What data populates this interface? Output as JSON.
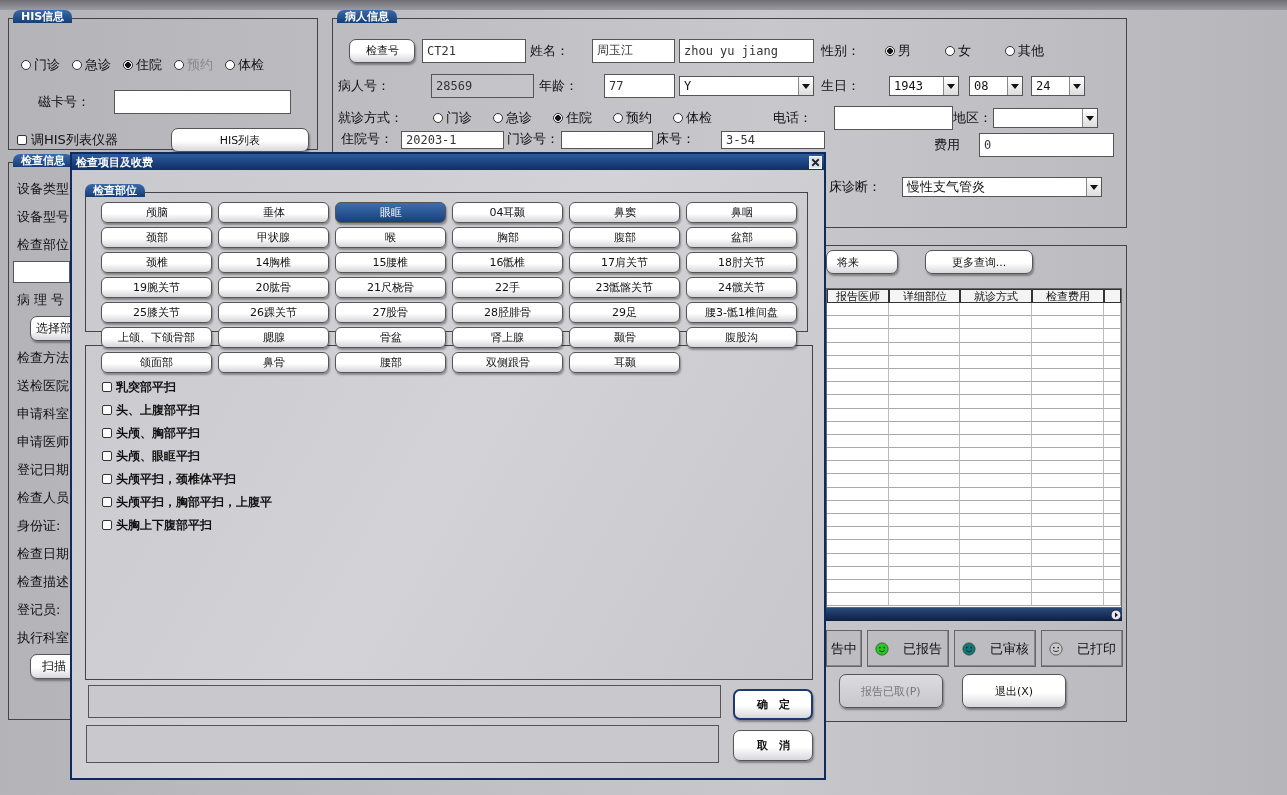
{
  "his": {
    "title": "HIS信息",
    "visit_types": [
      {
        "label": "门诊",
        "selected": false,
        "disabled": false
      },
      {
        "label": "急诊",
        "selected": false,
        "disabled": false
      },
      {
        "label": "住院",
        "selected": true,
        "disabled": false
      },
      {
        "label": "预约",
        "selected": false,
        "disabled": true
      },
      {
        "label": "体检",
        "selected": false,
        "disabled": false
      }
    ],
    "card_label": "磁卡号：",
    "checkbox": {
      "label": "调HIS列表仪器",
      "checked": false
    },
    "button": "HIS列表"
  },
  "exam_info": {
    "title": "检查信息",
    "items": [
      {
        "kind": "label",
        "text": "设备类型"
      },
      {
        "kind": "label",
        "text": "设备型号"
      },
      {
        "kind": "label",
        "text": "检查部位"
      },
      {
        "kind": "field"
      },
      {
        "kind": "label",
        "text": "病 理 号"
      },
      {
        "kind": "button",
        "text": "选择部"
      },
      {
        "kind": "label",
        "text": "检查方法"
      },
      {
        "kind": "label",
        "text": "送检医院"
      },
      {
        "kind": "label",
        "text": "申请科室"
      },
      {
        "kind": "label",
        "text": "申请医师"
      },
      {
        "kind": "label",
        "text": "登记日期"
      },
      {
        "kind": "label",
        "text": "检查人员"
      },
      {
        "kind": "label",
        "text": "身份证:"
      },
      {
        "kind": "label",
        "text": "检查日期"
      },
      {
        "kind": "label",
        "text": "检查描述"
      },
      {
        "kind": "label",
        "text": "登记员:"
      },
      {
        "kind": "label",
        "text": "执行科室"
      },
      {
        "kind": "button",
        "text": "扫描"
      }
    ]
  },
  "patient": {
    "title": "病人信息",
    "exam_no_button": "检查号",
    "exam_no": "CT21",
    "name_label": "姓名：",
    "name": "周玉江",
    "name_pinyin": "zhou yu jiang",
    "gender_label": "性别：",
    "genders": [
      {
        "label": "男",
        "selected": true
      },
      {
        "label": "女",
        "selected": false
      },
      {
        "label": "其他",
        "selected": false
      }
    ],
    "patient_no_label": "病人号：",
    "patient_no": "28569",
    "age_label": "年龄：",
    "age": "77",
    "age_unit": "Y",
    "birthday_label": "生日：",
    "birth_year": "1943",
    "birth_month": "08",
    "birth_day": "24",
    "visit_label": "就诊方式：",
    "visits": [
      {
        "label": "门诊",
        "selected": false
      },
      {
        "label": "急诊",
        "selected": false
      },
      {
        "label": "住院",
        "selected": true
      },
      {
        "label": "预约",
        "selected": false
      },
      {
        "label": "体检",
        "selected": false
      }
    ],
    "phone_label": "电话：",
    "region_label": "地区：",
    "inpatient_label": "住院号：",
    "inpatient_no": "20203-1",
    "outpatient_label": "门诊号：",
    "bed_label": "床号：",
    "bed_no": "3-54",
    "fee_label": "费用",
    "fee": "0",
    "diagnosis_label": "床诊断：",
    "diagnosis": "慢性支气管炎"
  },
  "records": {
    "buttons": [
      "将来",
      "更多查询..."
    ],
    "table": {
      "columns": [
        "报告医师",
        "详细部位",
        "就诊方式",
        "检查费用"
      ]
    },
    "statuses": [
      {
        "label": "告中"
      },
      {
        "label": "已报告",
        "color": "#22cc22"
      },
      {
        "label": "已审核",
        "color": "#117777"
      },
      {
        "label": "已打印",
        "color": "#c8c8c8"
      }
    ],
    "actions": [
      {
        "label": "报告已取(P)",
        "disabled": true
      },
      {
        "label": "退出(X)",
        "disabled": false
      }
    ]
  },
  "dialog": {
    "title": "检查项目及收费",
    "group_title": "检查部位",
    "parts": [
      {
        "label": "颅脑",
        "selected": false
      },
      {
        "label": "垂体",
        "selected": false
      },
      {
        "label": "眼眶",
        "selected": true
      },
      {
        "label": "04耳颞",
        "selected": false
      },
      {
        "label": "鼻窦",
        "selected": false
      },
      {
        "label": "鼻咽",
        "selected": false
      },
      {
        "label": "颈部",
        "selected": false
      },
      {
        "label": "甲状腺",
        "selected": false
      },
      {
        "label": "喉",
        "selected": false
      },
      {
        "label": "胸部",
        "selected": false
      },
      {
        "label": "腹部",
        "selected": false
      },
      {
        "label": "盆部",
        "selected": false
      },
      {
        "label": "颈椎",
        "selected": false
      },
      {
        "label": "14胸椎",
        "selected": false
      },
      {
        "label": "15腰椎",
        "selected": false
      },
      {
        "label": "16骶椎",
        "selected": false
      },
      {
        "label": "17肩关节",
        "selected": false
      },
      {
        "label": "18肘关节",
        "selected": false
      },
      {
        "label": "19腕关节",
        "selected": false
      },
      {
        "label": "20肱骨",
        "selected": false
      },
      {
        "label": "21尺桡骨",
        "selected": false
      },
      {
        "label": "22手",
        "selected": false
      },
      {
        "label": "23骶髂关节",
        "selected": false
      },
      {
        "label": "24髋关节",
        "selected": false
      },
      {
        "label": "25膝关节",
        "selected": false
      },
      {
        "label": "26踝关节",
        "selected": false
      },
      {
        "label": "27股骨",
        "selected": false
      },
      {
        "label": "28胫腓骨",
        "selected": false
      },
      {
        "label": "29足",
        "selected": false
      },
      {
        "label": "腰3-骶1椎间盘",
        "selected": false
      },
      {
        "label": "上颌、下颌骨部",
        "selected": false
      },
      {
        "label": "腮腺",
        "selected": false
      },
      {
        "label": "骨盆",
        "selected": false
      },
      {
        "label": "肾上腺",
        "selected": false
      },
      {
        "label": "颞骨",
        "selected": false
      },
      {
        "label": "腹股沟",
        "selected": false
      },
      {
        "label": "颌面部",
        "selected": false
      },
      {
        "label": "鼻骨",
        "selected": false
      },
      {
        "label": "腰部",
        "selected": false
      },
      {
        "label": "双侧跟骨",
        "selected": false
      },
      {
        "label": "耳颞",
        "selected": false
      }
    ],
    "items": [
      {
        "label": "乳突部平扫",
        "checked": false
      },
      {
        "label": "头、上腹部平扫",
        "checked": false
      },
      {
        "label": "头颅、胸部平扫",
        "checked": false
      },
      {
        "label": "头颅、眼眶平扫",
        "checked": false
      },
      {
        "label": "头颅平扫，颈椎体平扫",
        "checked": false
      },
      {
        "label": "头颅平扫，胸部平扫，上腹平",
        "checked": false
      },
      {
        "label": "头胸上下腹部平扫",
        "checked": false
      }
    ],
    "buttons": [
      {
        "label": "确　定",
        "default": true
      },
      {
        "label": "取　消",
        "default": false
      }
    ]
  }
}
